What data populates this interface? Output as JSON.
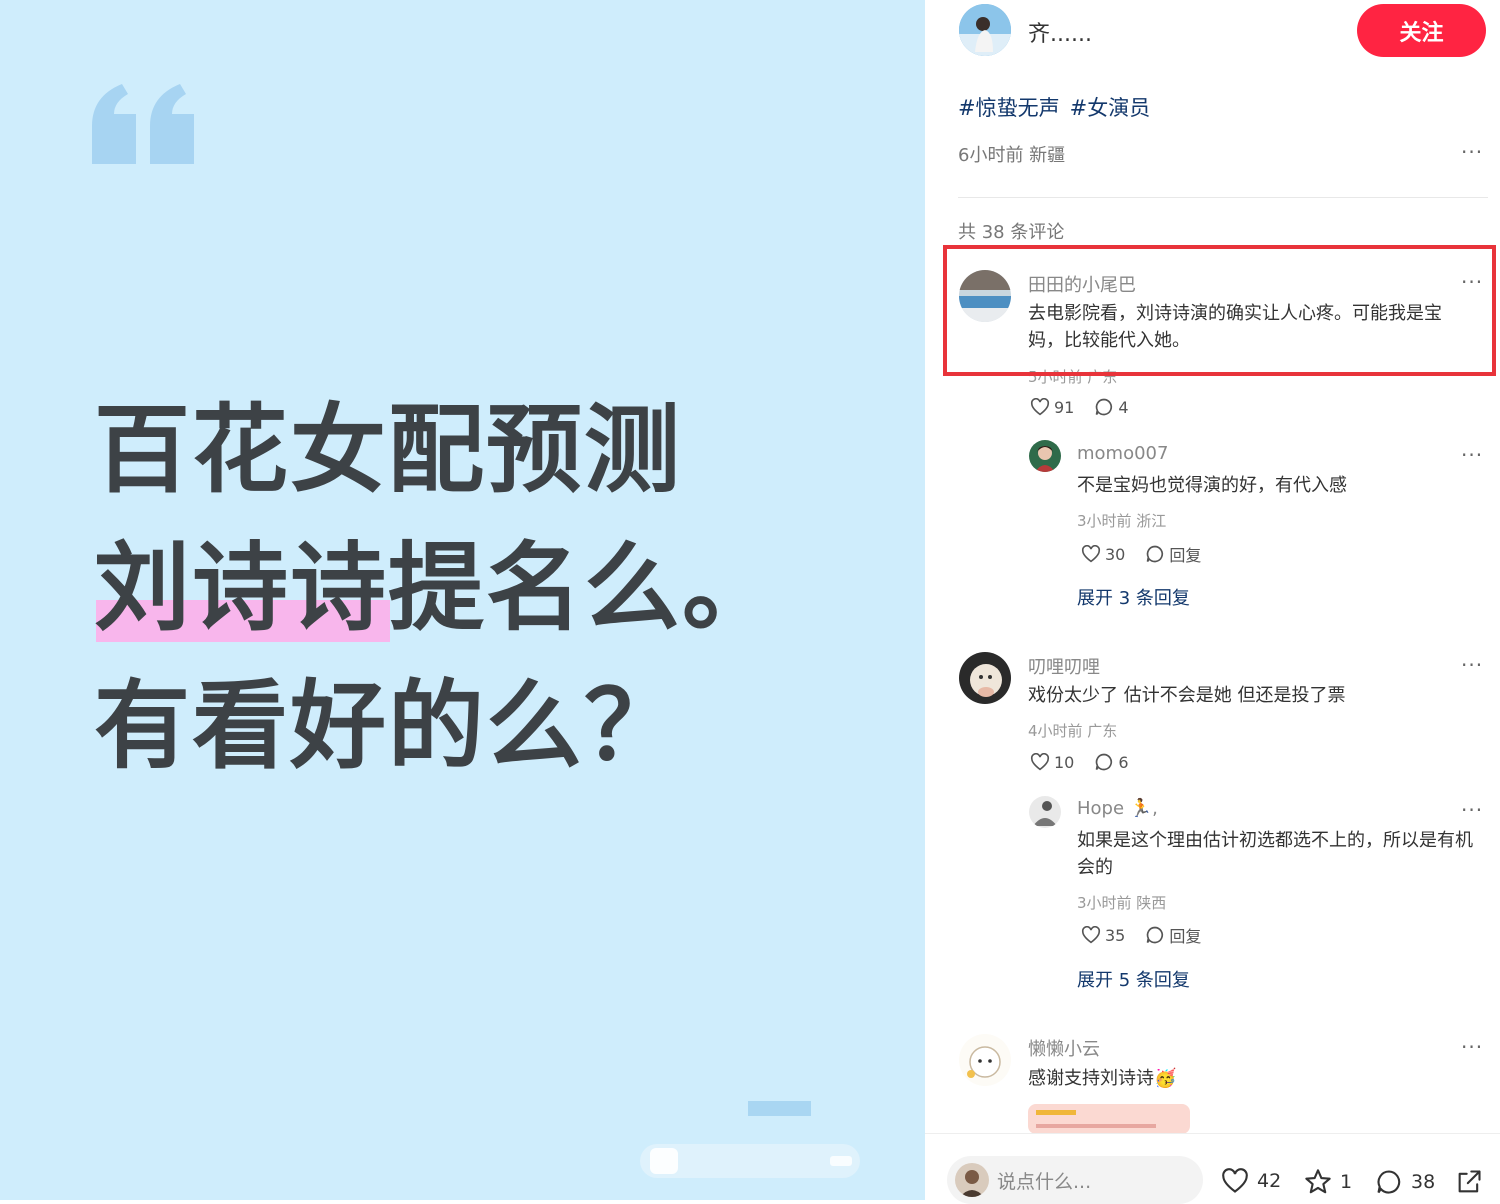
{
  "post_image": {
    "headline": [
      "百花女配预测",
      "刘诗诗提名么。",
      "有看好的么？"
    ]
  },
  "author": {
    "name": "齐......",
    "follow_label": "关注"
  },
  "post": {
    "hashtags": [
      "#惊蛰无声",
      "#女演员"
    ],
    "meta": "6小时前 新疆",
    "more": "···"
  },
  "comments": {
    "count_label": "共 38 条评论",
    "items": [
      {
        "name": "田田的小尾巴",
        "text": "去电影院看，刘诗诗演的确实让人心疼。可能我是宝妈，比较能代入她。",
        "meta": "5小时前 广东",
        "likes": "91",
        "replies": "4",
        "more": "···",
        "sub": {
          "name": "momo007",
          "text": "不是宝妈也觉得演的好，有代入感",
          "meta": "3小时前 浙江",
          "likes": "30",
          "reply_label": "回复",
          "more": "···"
        },
        "expand_label": "展开 3 条回复"
      },
      {
        "name": "叨哩叨哩",
        "text": "戏份太少了 估计不会是她 但还是投了票",
        "meta": "4小时前 广东",
        "likes": "10",
        "replies": "6",
        "more": "···",
        "sub": {
          "name": "Hope 🏃,",
          "text": "如果是这个理由估计初选都选不上的，所以是有机会的",
          "meta": "3小时前 陕西",
          "likes": "35",
          "reply_label": "回复",
          "more": "···"
        },
        "expand_label": "展开 5 条回复"
      },
      {
        "name": "懒懒小云",
        "text": "感谢支持刘诗诗🥳",
        "more": "···"
      }
    ]
  },
  "bottom_bar": {
    "input_placeholder": "说点什么...",
    "likes": "42",
    "favorites": "1",
    "comments": "38"
  },
  "colors": {
    "image_bg": "#cfedfc",
    "headline": "#3d4246",
    "highlight": "#f8b6ec",
    "follow": "#ff2442",
    "hashtag": "#13386c",
    "annotation_box": "#e8333a"
  },
  "icons": [
    "quote-icon",
    "heart-icon",
    "comment-bubble-icon",
    "star-icon",
    "share-icon",
    "more-icon"
  ]
}
